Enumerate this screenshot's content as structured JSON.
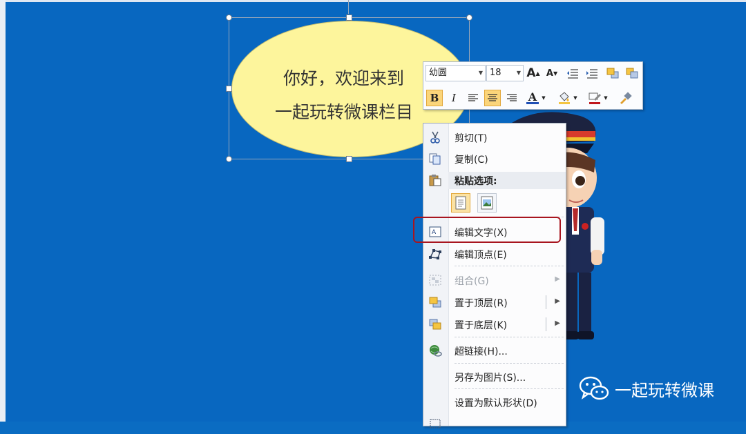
{
  "slide": {
    "bubble_line1": "你好，欢迎来到",
    "bubble_line2": "一起玩转微课栏目"
  },
  "mini_toolbar": {
    "font_name": "幼圆",
    "font_size": "18",
    "grow_font": "A",
    "shrink_font": "A",
    "bold": "B",
    "italic": "I",
    "font_color": "A"
  },
  "context_menu": {
    "items": [
      {
        "label": "剪切(T)",
        "icon": "scissors-icon",
        "enabled": true
      },
      {
        "label": "复制(C)",
        "icon": "copy-icon",
        "enabled": true
      },
      {
        "label": "粘贴选项:",
        "icon": "paste-icon",
        "enabled": true
      },
      {
        "label": "编辑文字(X)",
        "icon": "edit-text-icon",
        "enabled": true
      },
      {
        "label": "编辑顶点(E)",
        "icon": "edit-points-icon",
        "enabled": true
      },
      {
        "label": "组合(G)",
        "icon": "group-icon",
        "enabled": false
      },
      {
        "label": "置于顶层(R)",
        "icon": "bring-to-front-icon",
        "enabled": true
      },
      {
        "label": "置于底层(K)",
        "icon": "send-to-back-icon",
        "enabled": true
      },
      {
        "label": "超链接(H)...",
        "icon": "hyperlink-icon",
        "enabled": true
      },
      {
        "label": "另存为图片(S)...",
        "icon": "save-as-picture-icon",
        "enabled": true
      },
      {
        "label": "设置为默认形状(D)",
        "icon": "",
        "enabled": true
      }
    ]
  },
  "watermark": {
    "text": "一起玩转微课"
  },
  "colors": {
    "slide_background": "#0867c0",
    "bubble_fill": "#fdf59c",
    "highlight_border": "#a8151f",
    "active_button": "#fbd57a"
  }
}
